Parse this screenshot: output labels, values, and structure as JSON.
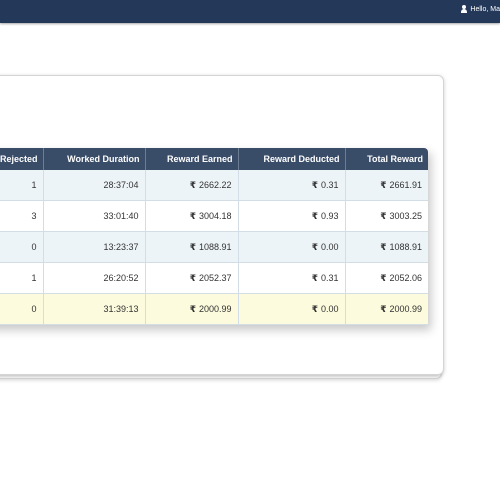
{
  "header": {
    "greeting": "Hello, Ma",
    "user_icon": "user-icon"
  },
  "table": {
    "columns": [
      "Rejected",
      "Worked Duration",
      "Reward Earned",
      "Reward Deducted",
      "Total Reward"
    ],
    "currency_symbol": "₹",
    "rows": [
      {
        "rejected": "1",
        "worked_duration": "28:37:04",
        "reward_earned": "2662.22",
        "reward_deducted": "0.31",
        "total_reward": "2661.91"
      },
      {
        "rejected": "3",
        "worked_duration": "33:01:40",
        "reward_earned": "3004.18",
        "reward_deducted": "0.93",
        "total_reward": "3003.25"
      },
      {
        "rejected": "0",
        "worked_duration": "13:23:37",
        "reward_earned": "1088.91",
        "reward_deducted": "0.00",
        "total_reward": "1088.91"
      },
      {
        "rejected": "1",
        "worked_duration": "26:20:52",
        "reward_earned": "2052.37",
        "reward_deducted": "0.31",
        "total_reward": "2052.06"
      },
      {
        "rejected": "0",
        "worked_duration": "31:39:13",
        "reward_earned": "2000.99",
        "reward_deducted": "0.00",
        "total_reward": "2000.99"
      }
    ]
  },
  "colors": {
    "topbar": "#24395a",
    "table_header": "#3a4d68",
    "row_alt": "#edf4f8",
    "row_highlight": "#fcfbdd"
  }
}
